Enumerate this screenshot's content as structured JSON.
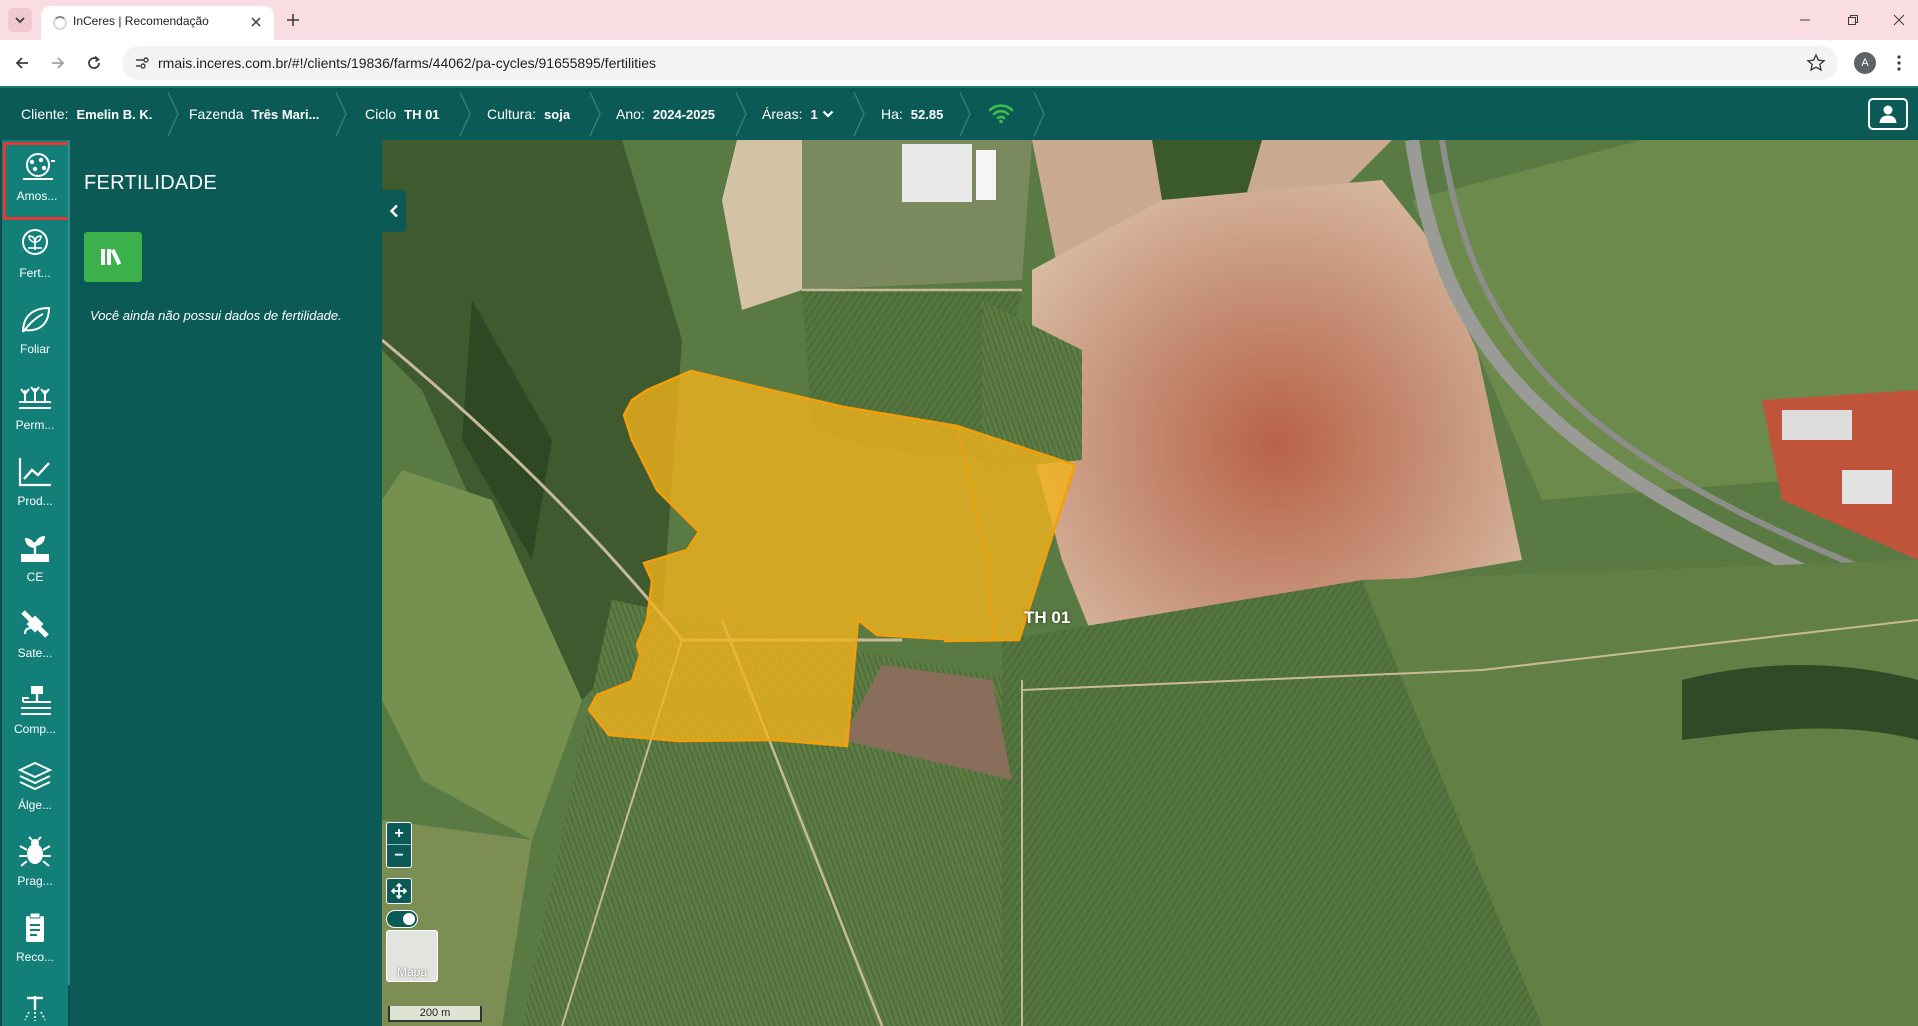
{
  "browser": {
    "tab_title": "InCeres | Recomendação",
    "url": "rmais.inceres.com.br/#!/clients/19836/farms/44062/pa-cycles/91655895/fertilities",
    "profile_initial": "A"
  },
  "header": {
    "cliente": {
      "label": "Cliente:",
      "value": "Emelin B. K."
    },
    "fazenda": {
      "label": "Fazenda",
      "value": "Três Mari..."
    },
    "ciclo": {
      "label": "Ciclo",
      "value": "TH 01"
    },
    "cultura": {
      "label": "Cultura:",
      "value": "soja"
    },
    "ano": {
      "label": "Ano:",
      "value": "2024-2025"
    },
    "areas": {
      "label": "Áreas:",
      "value": "1"
    },
    "ha": {
      "label": "Ha:",
      "value": "52.85"
    }
  },
  "rail": {
    "items": [
      {
        "label": "Amos...",
        "icon": "soil-sampling-icon",
        "selected": true
      },
      {
        "label": "Fert...",
        "icon": "fertility-icon"
      },
      {
        "label": "Foliar",
        "icon": "leaf-icon"
      },
      {
        "label": "Perm...",
        "icon": "perennial-crop-icon"
      },
      {
        "label": "Prod...",
        "icon": "productivity-chart-icon"
      },
      {
        "label": "CE",
        "icon": "plant-ce-icon"
      },
      {
        "label": "Sate...",
        "icon": "satellite-icon"
      },
      {
        "label": "Comp...",
        "icon": "compaction-icon"
      },
      {
        "label": "Álge...",
        "icon": "layers-icon"
      },
      {
        "label": "Prag...",
        "icon": "pest-bug-icon"
      },
      {
        "label": "Reco...",
        "icon": "recommendation-icon"
      }
    ]
  },
  "panel": {
    "title": "FERTILIDADE",
    "empty_message": "Você ainda não possui dados de fertilidade."
  },
  "map": {
    "field_label": "TH 01",
    "zoom_in": "+",
    "zoom_out": "−",
    "basemap_label": "Mapa",
    "scale_label": "200 m"
  },
  "colors": {
    "header_bg": "#0b5a55",
    "rail_bg": "#127f78",
    "field_fill": "#f4b31a",
    "field_stroke": "#f29f0c",
    "library_button": "#3cb04a",
    "selected_outline": "#e53935"
  }
}
